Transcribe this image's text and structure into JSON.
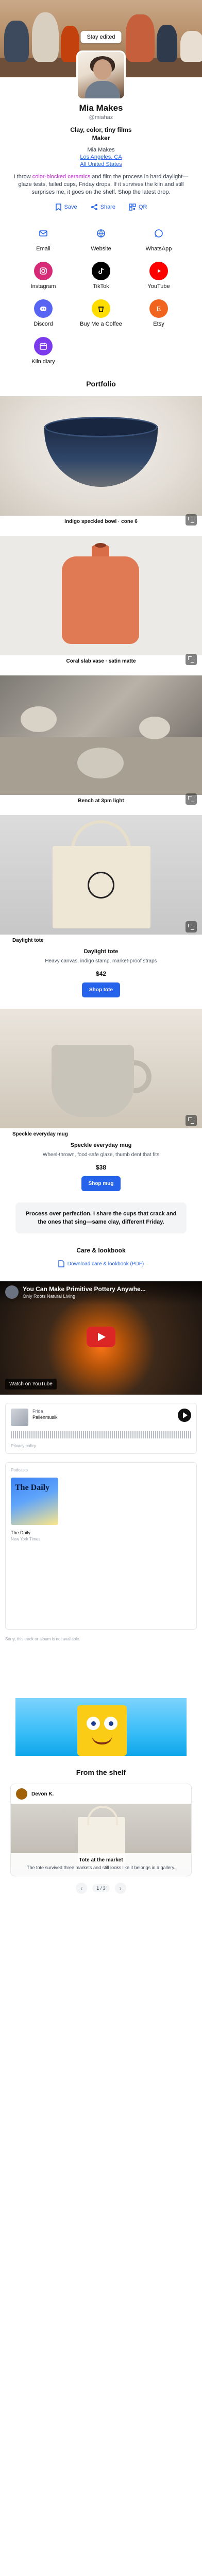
{
  "cover": {
    "edit_label": "Stay edited"
  },
  "profile": {
    "name": "Mia Makes",
    "handle": "@miahaz",
    "tagline_1": "Clay, color, tiny films",
    "tagline_2": "Maker",
    "meta_role": "Mia Makes",
    "meta_location": "Los Angeles, CA",
    "meta_country": "All United States",
    "bio_pre": "I throw ",
    "bio_highlight": "color-blocked ceramics",
    "bio_post": " and film the process in hard daylight—glaze tests, failed cups, Friday drops. If it survives the kiln and still surprises me, it goes on the shelf. Shop the latest drop."
  },
  "actions": {
    "save": "Save",
    "share": "Share",
    "qr": "QR"
  },
  "links": [
    {
      "label": "Email",
      "icon": "email-icon",
      "bg": "transparent",
      "fg": "#2563eb"
    },
    {
      "label": "Website",
      "icon": "globe-icon",
      "bg": "transparent",
      "fg": "#2563eb"
    },
    {
      "label": "WhatsApp",
      "icon": "whatsapp-icon",
      "bg": "transparent",
      "fg": "#2563eb"
    },
    {
      "label": "Instagram",
      "icon": "instagram-icon",
      "bg": "#d62976",
      "fg": "#ffffff"
    },
    {
      "label": "TikTok",
      "icon": "tiktok-icon",
      "bg": "#000000",
      "fg": "#ffffff"
    },
    {
      "label": "YouTube",
      "icon": "youtube-icon",
      "bg": "#ff0000",
      "fg": "#ffffff"
    },
    {
      "label": "Discord",
      "icon": "discord-icon",
      "bg": "#5865f2",
      "fg": "#ffffff"
    },
    {
      "label": "Buy Me a Coffee",
      "icon": "coffee-icon",
      "bg": "#ffdd00",
      "fg": "#000000"
    },
    {
      "label": "Etsy",
      "icon": "etsy-icon",
      "bg": "#f1641e",
      "fg": "#ffffff"
    },
    {
      "label": "Kiln diary",
      "icon": "calendar-icon",
      "bg": "#7c3aed",
      "fg": "#ffffff"
    }
  ],
  "portfolio": {
    "title": "Portfolio",
    "items": [
      {
        "caption": "Indigo speckled bowl · cone 6"
      },
      {
        "caption": "Coral slab vase · satin matte"
      },
      {
        "caption": "Bench at 3pm light"
      }
    ]
  },
  "products": [
    {
      "caption": "Daylight tote",
      "title": "Daylight tote",
      "desc": "Heavy canvas, indigo stamp, market-proof straps",
      "price": "$42",
      "cta": "Shop tote"
    },
    {
      "caption": "Speckle everyday mug",
      "title": "Speckle everyday mug",
      "desc": "Wheel-thrown, food-safe glaze, thumb dent that fits",
      "price": "$38",
      "cta": "Shop mug"
    }
  ],
  "quote": "Process over perfection. I share the cups that crack and the ones that sing—same clay, different Friday.",
  "care": {
    "title": "Care & lookbook",
    "download": "Download care & lookbook (PDF)"
  },
  "youtube": {
    "title": "You Can Make Primitive Pottery Anywhe...",
    "sub": "Only Roots Natural Living",
    "watch": "Watch on YouTube"
  },
  "podcast": {
    "name": "Frida",
    "episode": "Palienmusik",
    "foot": "Privacy policy"
  },
  "applepodcast": {
    "top": "Podcasts",
    "cover": "The Daily",
    "episode": "The Daily",
    "meta": "New York Times"
  },
  "note": "Sorry, this track or album is not available.",
  "shelf": {
    "title": "From the shelf",
    "user": "Devon K.",
    "post_title": "Tote at the market",
    "post_desc": "The tote survived three markets and still looks like it belongs in a gallery.",
    "pager": "1 / 3"
  }
}
